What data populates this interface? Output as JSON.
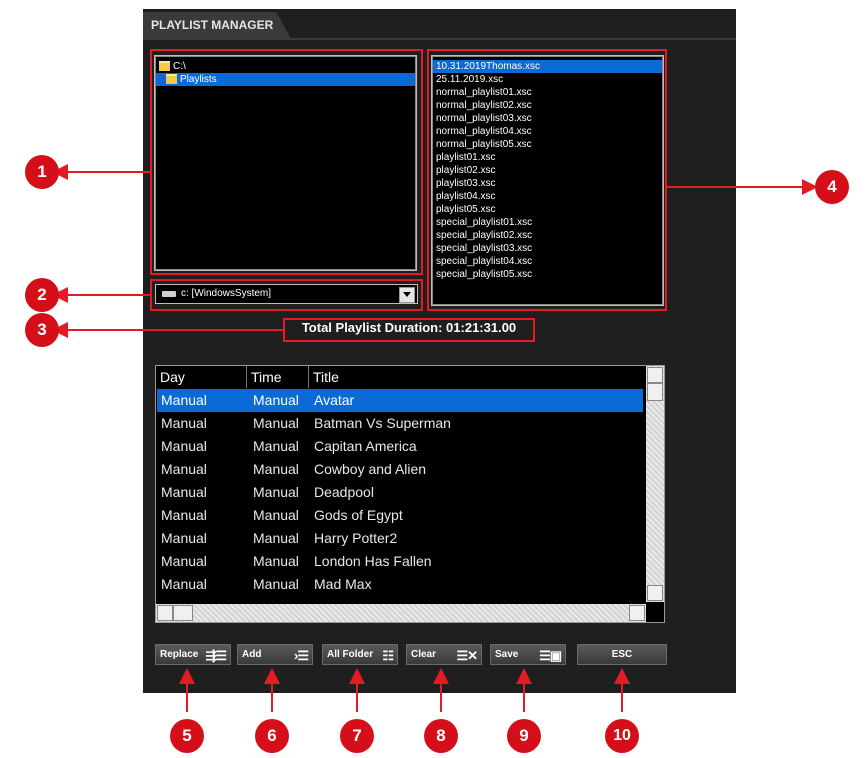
{
  "window": {
    "tab_title": "PLAYLIST MANAGER"
  },
  "folders": [
    {
      "label": "C:\\",
      "selected": false
    },
    {
      "label": "Playlists",
      "selected": true
    }
  ],
  "drive_select": {
    "value": "c: [WindowsSystem]"
  },
  "files": [
    "10.31.2019Thomas.xsc",
    "25.11.2019.xsc",
    "normal_playlist01.xsc",
    "normal_playlist02.xsc",
    "normal_playlist03.xsc",
    "normal_playlist04.xsc",
    "normal_playlist05.xsc",
    "playlist01.xsc",
    "playlist02.xsc",
    "playlist03.xsc",
    "playlist04.xsc",
    "playlist05.xsc",
    "special_playlist01.xsc",
    "special_playlist02.xsc",
    "special_playlist03.xsc",
    "special_playlist04.xsc",
    "special_playlist05.xsc"
  ],
  "selected_file_index": 0,
  "duration_label": "Total Playlist Duration: 01:21:31.00",
  "table": {
    "columns": [
      "Day",
      "Time",
      "Title"
    ],
    "rows": [
      [
        "Manual",
        "Manual",
        "Avatar"
      ],
      [
        "Manual",
        "Manual",
        "Batman Vs Superman"
      ],
      [
        "Manual",
        "Manual",
        "Capitan America"
      ],
      [
        "Manual",
        "Manual",
        "Cowboy and Alien"
      ],
      [
        "Manual",
        "Manual",
        "Deadpool"
      ],
      [
        "Manual",
        "Manual",
        "Gods of Egypt"
      ],
      [
        "Manual",
        "Manual",
        "Harry Potter2"
      ],
      [
        "Manual",
        "Manual",
        "London Has Fallen"
      ],
      [
        "Manual",
        "Manual",
        "Mad Max"
      ]
    ],
    "selected_row": 0
  },
  "buttons": [
    {
      "label": "Replace",
      "icon": "replace-list-icon"
    },
    {
      "label": "Add",
      "icon": "add-list-icon"
    },
    {
      "label": "All Folder",
      "icon": "all-folder-icon"
    },
    {
      "label": "Clear",
      "icon": "clear-list-icon"
    },
    {
      "label": "Save",
      "icon": "save-list-icon"
    },
    {
      "label": "ESC",
      "icon": ""
    }
  ],
  "callouts": [
    "1",
    "2",
    "3",
    "4",
    "5",
    "6",
    "7",
    "8",
    "9",
    "10"
  ],
  "colors": {
    "accent": "#e31b23",
    "selection": "#0a6ad6",
    "panel": "#1f1f1f"
  }
}
